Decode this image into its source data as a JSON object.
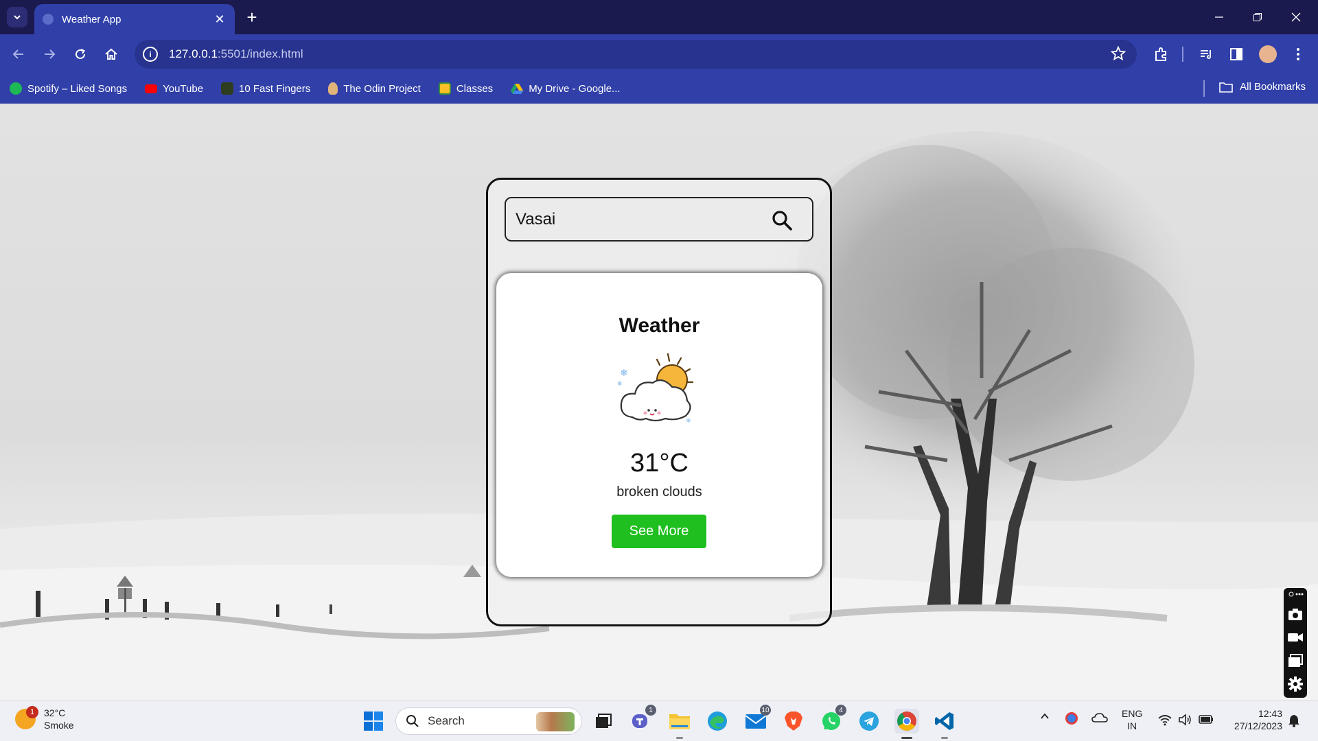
{
  "browser": {
    "tab": {
      "title": "Weather App"
    },
    "url": {
      "host": "127.0.0.1",
      "path": ":5501/index.html"
    },
    "bookmarks": [
      {
        "label": "Spotify – Liked Songs",
        "icon": "spotify-icon",
        "color": "#1db954"
      },
      {
        "label": "YouTube",
        "icon": "youtube-icon",
        "color": "#ff0000"
      },
      {
        "label": "10 Fast Fingers",
        "icon": "fast-fingers-icon",
        "color": "#2e3c1f"
      },
      {
        "label": "The Odin Project",
        "icon": "odin-icon",
        "color": "#e0b37a"
      },
      {
        "label": "Classes",
        "icon": "classroom-icon",
        "color": "#f6c026"
      },
      {
        "label": "My Drive - Google...",
        "icon": "drive-icon",
        "color": "#1fa463"
      }
    ],
    "all_bookmarks": "All Bookmarks"
  },
  "app": {
    "search": {
      "value": "Vasai"
    },
    "weather": {
      "title": "Weather",
      "temperature": "31°C",
      "description": "broken clouds",
      "button": "See More",
      "icon": "cloud-sun-icon"
    }
  },
  "taskbar": {
    "weather": {
      "temp": "32°C",
      "condition": "Smoke",
      "badge": "1"
    },
    "search_placeholder": "Search",
    "badges": {
      "teams": "1",
      "mail": "10",
      "whatsapp": "4"
    },
    "language": {
      "line1": "ENG",
      "line2": "IN"
    },
    "clock": {
      "time": "12:43",
      "date": "27/12/2023"
    }
  },
  "colors": {
    "chrome": "#3140a8",
    "tabstrip": "#1a1a4e",
    "accent_button": "#1fbf1f"
  }
}
